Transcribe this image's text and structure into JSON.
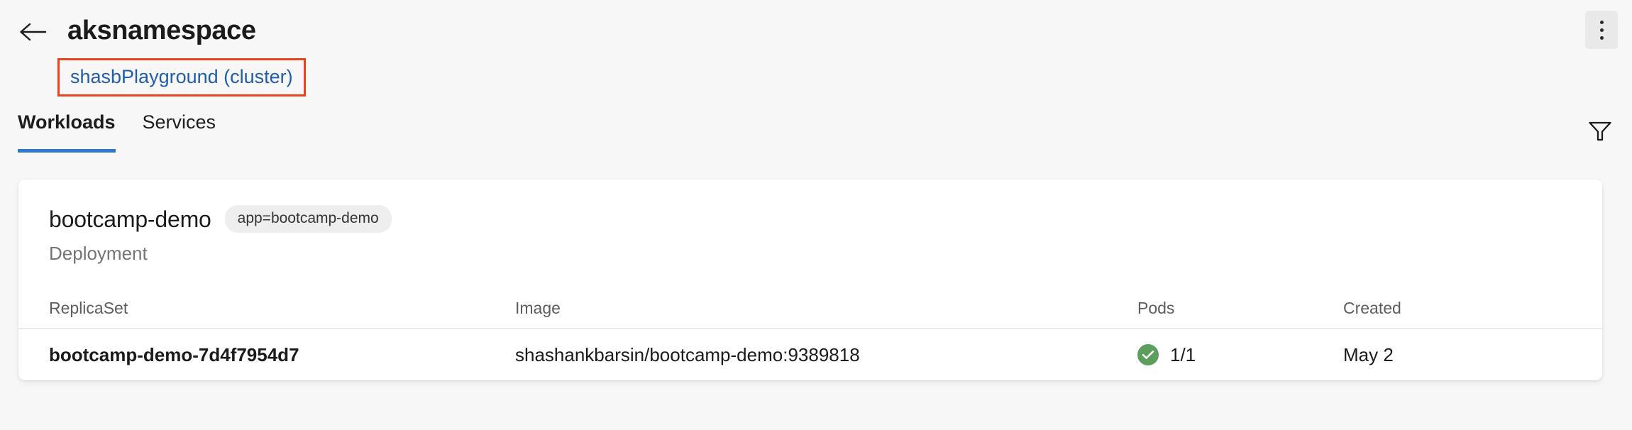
{
  "header": {
    "back_icon": "arrow-left-icon",
    "title": "aksnamespace",
    "cluster_link": "shasbPlayground (cluster)",
    "kebab_icon": "more-vertical-icon",
    "annotation_color": "#e5441f",
    "link_color": "#225ea8"
  },
  "tabs": {
    "filter_icon": "filter-funnel-icon",
    "active_color": "#2f78c8",
    "items": [
      {
        "label": "Workloads",
        "active": true
      },
      {
        "label": "Services",
        "active": false
      }
    ]
  },
  "card": {
    "title": "bootcamp-demo",
    "chip": "app=bootcamp-demo",
    "subtitle": "Deployment",
    "table": {
      "columns": [
        "ReplicaSet",
        "Image",
        "Pods",
        "Created"
      ],
      "rows": [
        {
          "replicaset": "bootcamp-demo-7d4f7954d7",
          "image": "shashankbarsin/bootcamp-demo:9389818",
          "pods": "1/1",
          "pods_status_icon": "check-circle-icon",
          "pods_status_color": "#5c9e5c",
          "created": "May 2"
        }
      ]
    }
  }
}
